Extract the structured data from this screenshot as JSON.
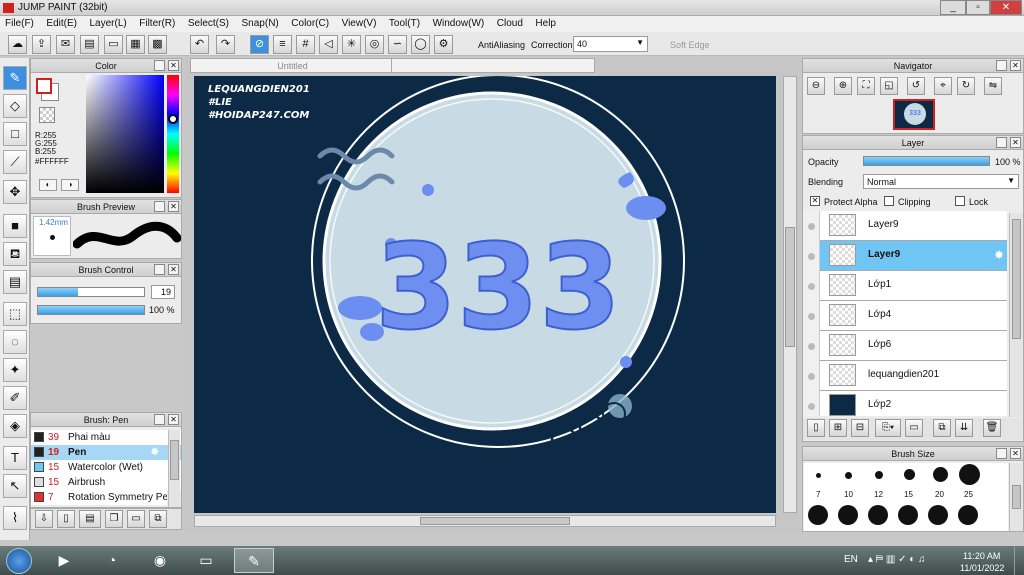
{
  "window": {
    "title": "JUMP PAINT (32bit)",
    "min": "_",
    "max": "▫",
    "close": "✕"
  },
  "menu": [
    "File(F)",
    "Edit(E)",
    "Layer(L)",
    "Filter(R)",
    "Select(S)",
    "Snap(N)",
    "Color(C)",
    "View(V)",
    "Tool(T)",
    "Window(W)",
    "Cloud",
    "Help"
  ],
  "toolbar": {
    "antialias_label": "AntiAliasing",
    "correction_label": "Correction",
    "correction_value": "40",
    "soft_edge_label": "Soft Edge"
  },
  "canvas": {
    "tab_title": "Untitled",
    "watermark_lines": [
      "LEQUANGDIEN201",
      "#LIE",
      "#HOIDAP247.COM"
    ],
    "artwork_text": "333"
  },
  "color_panel": {
    "title": "Color",
    "r": "R:255",
    "g": "G:255",
    "b": "B:255",
    "hex": "#FFFFFF"
  },
  "brush_preview": {
    "title": "Brush Preview",
    "size": "1.42mm"
  },
  "brush_control": {
    "title": "Brush Control",
    "size_value": "19",
    "opacity_value": "100 %",
    "size_fraction": 0.38,
    "opacity_fraction": 1.0
  },
  "brush_list": {
    "title": "Brush: Pen",
    "items": [
      {
        "size": "39",
        "name": "Phai màu",
        "color": "#222222"
      },
      {
        "size": "19",
        "name": "Pen",
        "color": "#222222"
      },
      {
        "size": "15",
        "name": "Watercolor (Wet)",
        "color": "#6ec8f0"
      },
      {
        "size": "15",
        "name": "Airbrush",
        "color": "#dddddd"
      },
      {
        "size": "7",
        "name": "Rotation Symmetry Pen",
        "color": "#e03030"
      }
    ],
    "selected_index": 1
  },
  "navigator": {
    "title": "Navigator",
    "thumb_text": "333"
  },
  "layer_panel": {
    "title": "Layer",
    "opacity_label": "Opacity",
    "opacity_value": "100 %",
    "blending_label": "Blending",
    "blending_value": "Normal",
    "protect_alpha": "Protect Alpha",
    "clipping": "Clipping",
    "lock": "Lock",
    "layers": [
      "Layer9",
      "Layer9",
      "Lớp1",
      "Lớp4",
      "Lớp6",
      "lequangdien201",
      "Lớp2"
    ],
    "selected_index": 1
  },
  "brush_size": {
    "title": "Brush Size",
    "sizes": [
      "7",
      "10",
      "12",
      "15",
      "20",
      "25"
    ]
  },
  "taskbar": {
    "lang": "EN",
    "time": "11:20 AM",
    "date": "11/01/2022"
  }
}
